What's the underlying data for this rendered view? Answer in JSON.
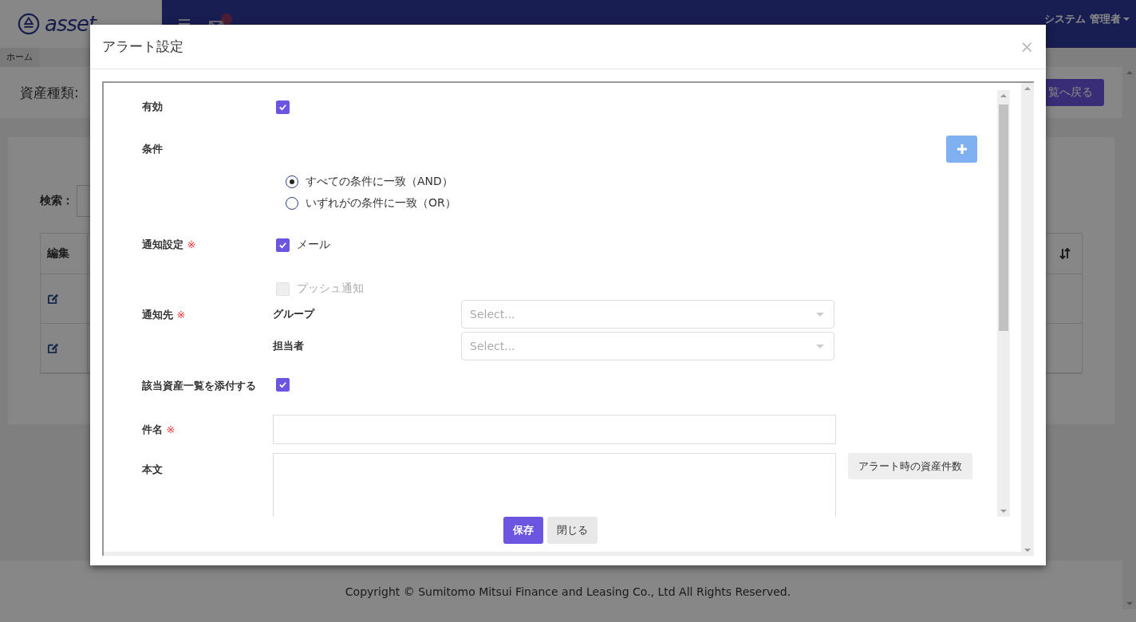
{
  "header": {
    "logo": "asset",
    "user": "システム 管理者"
  },
  "breadcrumb": [
    "ホーム"
  ],
  "page": {
    "title": "資産種類:",
    "back_button": "覧へ戻る",
    "search_label": "検索：",
    "table": {
      "columns": [
        "編集"
      ],
      "rows": [
        {
          "kind": "editable"
        },
        {
          "kind": "editable"
        }
      ]
    }
  },
  "footer": "Copyright © Sumitomo Mitsui Finance and Leasing Co., Ltd All Rights Reserved.",
  "modal": {
    "title": "アラート設定",
    "close": "×",
    "enabled": {
      "label": "有効",
      "checked": true
    },
    "condition": {
      "label": "条件",
      "options": [
        {
          "label": "すべての条件に一致（AND）",
          "selected": true
        },
        {
          "label": "いずれがの条件に一致（OR）",
          "selected": false
        }
      ]
    },
    "notification": {
      "label": "通知設定",
      "required_mark": "※",
      "options": [
        {
          "label": "メール",
          "checked": true,
          "disabled": false
        },
        {
          "label": "プッシュ通知",
          "checked": false,
          "disabled": true
        }
      ]
    },
    "recipients": {
      "label": "通知先",
      "required_mark": "※",
      "fields": [
        {
          "label": "グループ",
          "placeholder": "Select..."
        },
        {
          "label": "担当者",
          "placeholder": "Select..."
        }
      ]
    },
    "attach": {
      "label": "該当資産一覧を添付する",
      "checked": true
    },
    "subject": {
      "label": "件名",
      "required_mark": "※"
    },
    "body": {
      "label": "本文",
      "insert_button": "アラート時の資産件数"
    },
    "buttons": [
      {
        "label": "保存",
        "kind": "primary"
      },
      {
        "label": "閉じる",
        "kind": "secondary"
      }
    ]
  }
}
